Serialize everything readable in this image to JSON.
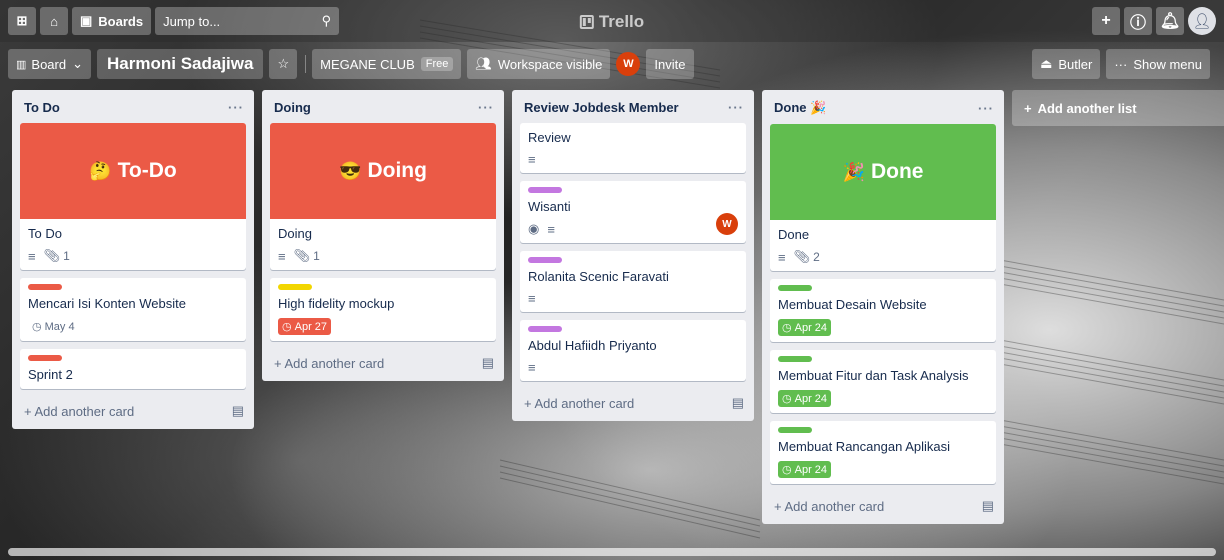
{
  "header": {
    "boards_label": "Boards",
    "search_placeholder": "Jump to...",
    "logo_text": "Trello"
  },
  "board": {
    "view_label": "Board",
    "name": "Harmoni Sadajiwa",
    "workspace": "MEGANE CLUB",
    "plan": "Free",
    "visibility": "Workspace visible",
    "member_initial": "W",
    "invite_label": "Invite",
    "butler_label": "Butler",
    "show_menu_label": "Show menu"
  },
  "lists": [
    {
      "title": "To Do",
      "cards": [
        {
          "cover_emoji": "🤔",
          "cover_text": "To-Do",
          "title": "To Do",
          "attachments": "1"
        },
        {
          "title": "Mencari Isi Konten Website",
          "due": "May 4"
        },
        {
          "title": "Sprint 2"
        }
      ],
      "add_label": "Add another card"
    },
    {
      "title": "Doing",
      "cards": [
        {
          "cover_emoji": "😎",
          "cover_text": "Doing",
          "title": "Doing",
          "attachments": "1"
        },
        {
          "title": "High fidelity mockup",
          "due": "Apr 27"
        }
      ],
      "add_label": "Add another card"
    },
    {
      "title": "Review Jobdesk Member",
      "cards": [
        {
          "title": "Review"
        },
        {
          "title": "Wisanti",
          "member_initial": "W"
        },
        {
          "title": "Rolanita Scenic Faravati"
        },
        {
          "title": "Abdul Hafiidh Priyanto"
        }
      ],
      "add_label": "Add another card"
    },
    {
      "title": "Done 🎉",
      "cards": [
        {
          "cover_emoji": "🎉",
          "cover_text": "Done",
          "title": "Done",
          "attachments": "2"
        },
        {
          "title": "Membuat Desain Website",
          "due": "Apr 24"
        },
        {
          "title": "Membuat Fitur dan Task Analysis",
          "due": "Apr 24"
        },
        {
          "title": "Membuat Rancangan Aplikasi",
          "due": "Apr 24"
        }
      ],
      "add_label": "Add another card"
    }
  ],
  "add_list_label": "Add another list",
  "colors": {
    "cover_red": "#eb5a46",
    "cover_green": "#61bd4f",
    "label_red": "#eb5a46",
    "label_yellow": "#f2d600",
    "label_purple": "#c377e0",
    "label_green": "#61bd4f"
  }
}
